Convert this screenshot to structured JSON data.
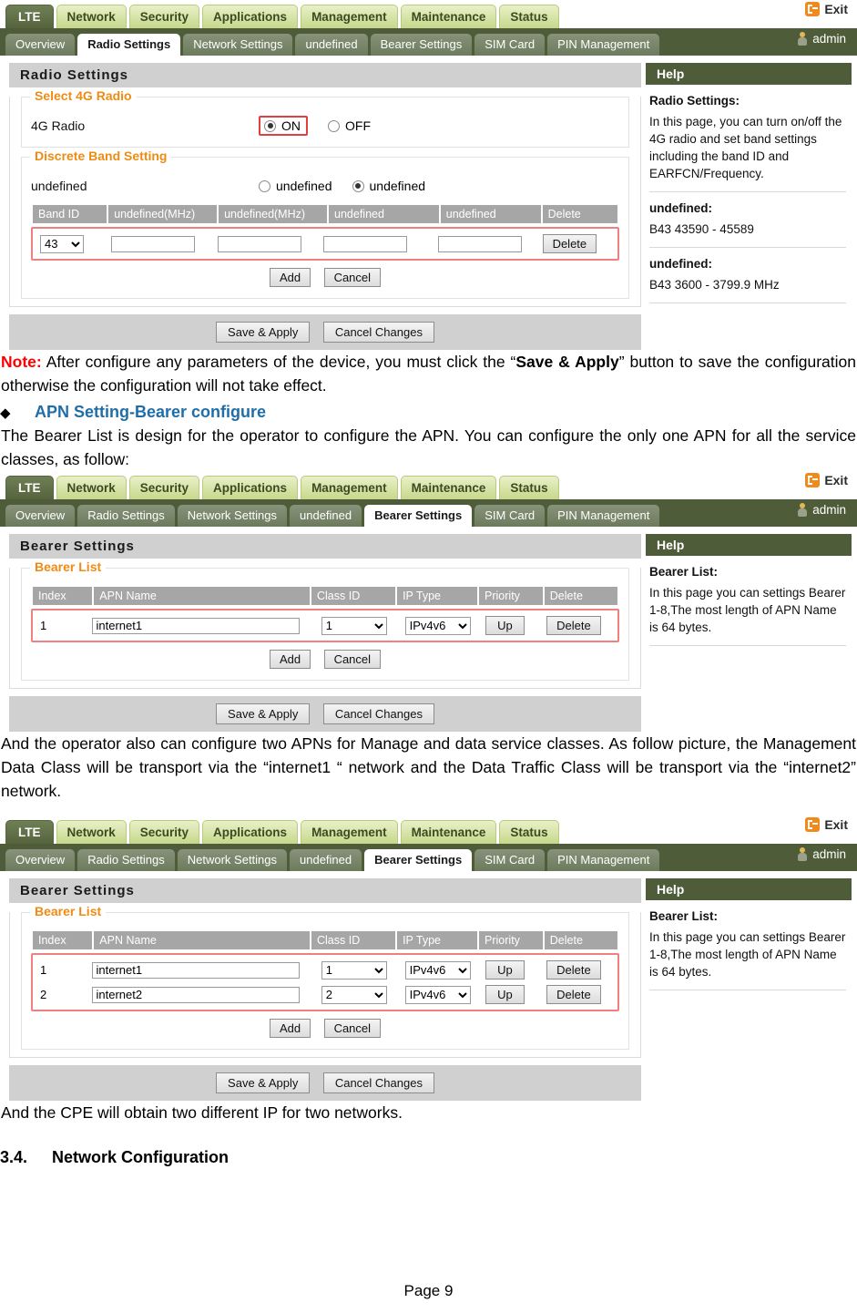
{
  "colors": {
    "nav_active": "#55643d",
    "nav_tab": "#c7d88b",
    "subnav_bg": "#4e5c39",
    "panel_title_bg": "#d0d0d0",
    "legend_orange": "#ef8b12",
    "highlight_red": "#e04040",
    "note_red": "#ff0000",
    "heading_blue": "#1f6ea8"
  },
  "nav": {
    "brand": "LTE",
    "tabs": [
      "Network",
      "Security",
      "Applications",
      "Management",
      "Maintenance",
      "Status"
    ],
    "exit_label": "Exit",
    "exit_icon": "exit-icon",
    "admin_label": "admin",
    "admin_icon": "user-icon"
  },
  "subnav": {
    "tabs": [
      "Overview",
      "Radio Settings",
      "Network Settings",
      "undefined",
      "Bearer Settings",
      "SIM Card",
      "PIN Management"
    ]
  },
  "shot1": {
    "active_subtab": "Radio Settings",
    "panel_title": "Radio Settings",
    "group1": {
      "legend": "Select 4G Radio",
      "label": "4G Radio",
      "options": [
        "ON",
        "OFF"
      ],
      "selected": "ON"
    },
    "group2": {
      "legend": "Discrete Band Setting",
      "label": "undefined",
      "options": [
        "undefined",
        "undefined"
      ],
      "selected_index": 1,
      "table": {
        "headers": [
          "Band ID",
          "undefined(MHz)",
          "undefined(MHz)",
          "undefined",
          "undefined",
          "Delete"
        ],
        "rows": [
          {
            "band_id": "43",
            "field1": "",
            "field2": "",
            "field3": "",
            "field4": "",
            "delete_label": "Delete"
          }
        ]
      },
      "add_label": "Add",
      "cancel_label": "Cancel"
    },
    "save_label": "Save & Apply",
    "cancel_changes_label": "Cancel Changes",
    "help": {
      "title": "Help",
      "sections": [
        {
          "heading": "Radio Settings:",
          "text": "In this page, you can turn on/off the 4G radio and set band settings including the band ID and EARFCN/Frequency."
        },
        {
          "heading": "undefined:",
          "text": "B43 43590 - 45589"
        },
        {
          "heading": "undefined:",
          "text": "B43 3600 - 3799.9 MHz"
        }
      ]
    }
  },
  "shot2": {
    "active_subtab": "Bearer Settings",
    "panel_title": "Bearer Settings",
    "group": {
      "legend": "Bearer List",
      "table": {
        "headers": [
          "Index",
          "APN Name",
          "Class ID",
          "IP Type",
          "Priority",
          "Delete"
        ],
        "rows": [
          {
            "index": "1",
            "apn_name": "internet1",
            "class_id": "1",
            "ip_type": "IPv4v6",
            "priority_label": "Up",
            "delete_label": "Delete"
          }
        ]
      },
      "add_label": "Add",
      "cancel_label": "Cancel"
    },
    "save_label": "Save & Apply",
    "cancel_changes_label": "Cancel Changes",
    "help": {
      "title": "Help",
      "sections": [
        {
          "heading": "Bearer List:",
          "text": "In this page you can settings Bearer 1-8,The most length of APN Name is 64 bytes."
        }
      ]
    }
  },
  "shot3": {
    "active_subtab": "Bearer Settings",
    "panel_title": "Bearer Settings",
    "group": {
      "legend": "Bearer List",
      "table": {
        "headers": [
          "Index",
          "APN Name",
          "Class ID",
          "IP Type",
          "Priority",
          "Delete"
        ],
        "rows": [
          {
            "index": "1",
            "apn_name": "internet1",
            "class_id": "1",
            "ip_type": "IPv4v6",
            "priority_label": "Up",
            "delete_label": "Delete"
          },
          {
            "index": "2",
            "apn_name": "internet2",
            "class_id": "2",
            "ip_type": "IPv4v6",
            "priority_label": "Up",
            "delete_label": "Delete"
          }
        ]
      },
      "add_label": "Add",
      "cancel_label": "Cancel"
    },
    "save_label": "Save & Apply",
    "cancel_changes_label": "Cancel Changes",
    "help": {
      "title": "Help",
      "sections": [
        {
          "heading": "Bearer List:",
          "text": "In this page you can settings Bearer 1-8,The most length of APN Name is 64 bytes."
        }
      ]
    }
  },
  "doc": {
    "note_prefix": "Note:",
    "note_part1": " After configure any parameters of the device, you must click the “",
    "note_bold": "Save & Apply",
    "note_part2": "” button to save the configuration otherwise the configuration will not take effect.",
    "bullet_glyph": "◆",
    "bullet_heading": "APN Setting-Bearer configure",
    "para1": "The Bearer List is design for the operator to configure the APN. You can configure the only one APN for all the service classes, as follow:",
    "para2": "And the operator also can configure two APNs for Manage and data service classes. As follow picture, the Management Data Class will be transport via the “internet1 “  network and the Data Traffic Class will be transport via the “internet2”  network.",
    "para3": "And the CPE will obtain two different IP for two networks.",
    "section_number": "3.4.",
    "section_title": "Network Configuration",
    "page_label": "Page 9"
  }
}
